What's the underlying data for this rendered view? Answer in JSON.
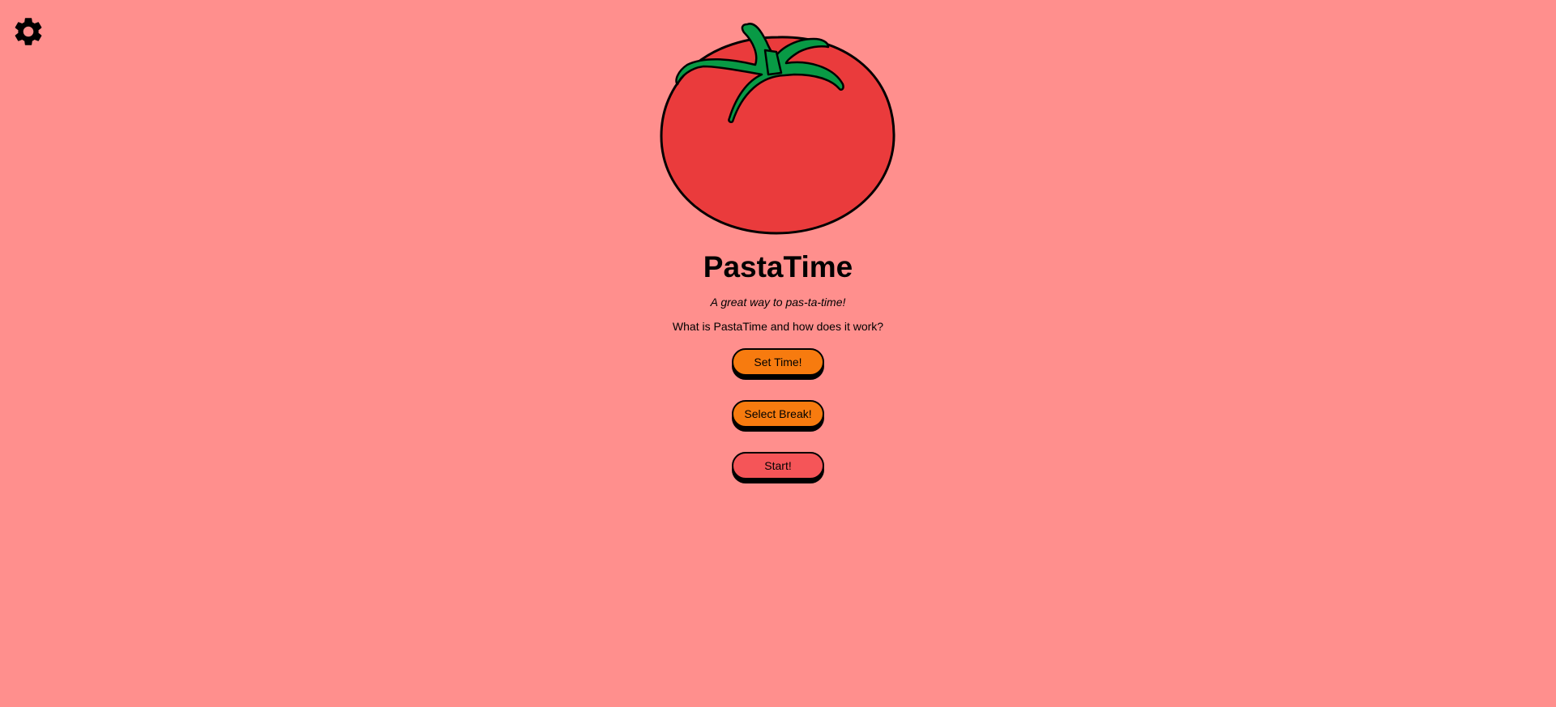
{
  "header": {
    "settings_icon": "gear-icon"
  },
  "hero": {
    "image_icon": "tomato-icon"
  },
  "main": {
    "title": "PastaTime",
    "tagline": "A great way to pas-ta-time!",
    "info_link": "What is PastaTime and how does it work?",
    "buttons": {
      "set_time": "Set Time!",
      "select_break": "Select Break!",
      "start": "Start!"
    }
  },
  "colors": {
    "background": "#ff8f8d",
    "tomato_body": "#ea3b3c",
    "tomato_leaves": "#089a45",
    "button_orange": "#f77b0f",
    "button_red": "#f55558"
  }
}
